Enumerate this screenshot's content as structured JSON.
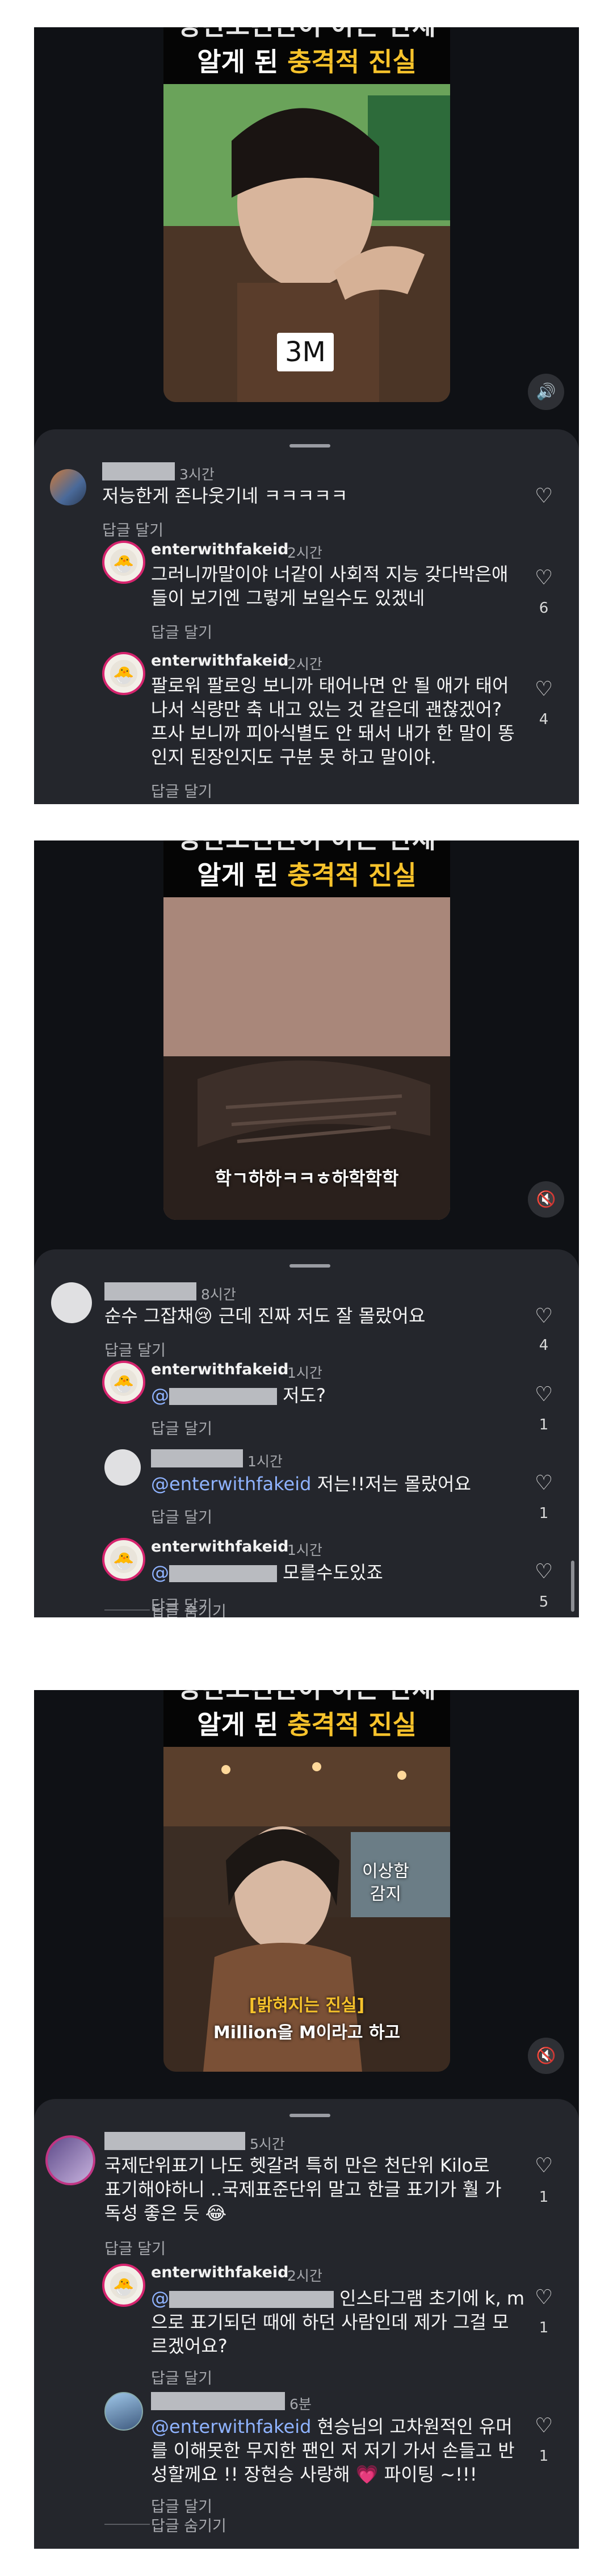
{
  "banner": {
    "line_top": "방탄소년단이 아는 단체",
    "main_prefix": "알게 된 ",
    "main_highlight": "충격적 진실"
  },
  "panel1": {
    "video_caption": "3M",
    "sound_icon": "sound-on",
    "comments": [
      {
        "time": "3시간",
        "text": "저능한게 존나웃기네 ㅋㅋㅋㅋㅋ",
        "reply": "답글 달기"
      },
      {
        "username": "enterwithfakeid",
        "time": "2시간",
        "text": "그러니까말이야 너같이 사회적 지능 갖다박은애\n들이 보기엔 그렇게 보일수도 있겠네",
        "reply": "답글 달기",
        "likes": "6"
      },
      {
        "username": "enterwithfakeid",
        "time": "2시간",
        "text": "팔로워 팔로잉 보니까 태어나면 안 될 애가 태어\n나서 식량만 축 내고 있는 것 같은데 괜찮겠어?\n프사 보니까 피아식별도 안 돼서 내가 한 말이 똥\n인지 된장인지도 구분 못 하고 말이야.",
        "reply": "답글 달기",
        "likes": "4"
      }
    ]
  },
  "panel2": {
    "video_caption": "학ㄱ하하ㅋㅋㅎ하학학학",
    "sound_icon": "sound-muted",
    "comments": [
      {
        "time": "8시간",
        "text": "순수 그잡채😢 근데 진짜 저도 잘  몰랐어요",
        "reply": "답글 달기",
        "likes": "4"
      },
      {
        "username": "enterwithfakeid",
        "time": "1시간",
        "mention": "@",
        "text": " 저도?",
        "reply": "답글 달기",
        "likes": "1"
      },
      {
        "time": "1시간",
        "mention": "@enterwithfakeid",
        "text": " 저는!!저는 몰랐어요",
        "reply": "답글 달기",
        "likes": "1"
      },
      {
        "username": "enterwithfakeid",
        "time": "1시간",
        "mention": "@",
        "text": " 모를수도있죠",
        "reply": "답글 달기",
        "likes": "5"
      }
    ],
    "hide_replies": "답글 숨기기"
  },
  "panel3": {
    "video_label": "이상함\n감지",
    "subtitle_yellow": "[밝혀지는 진실]",
    "subtitle_white": "Million을 M이라고 하고",
    "sound_icon": "sound-muted",
    "comments": [
      {
        "time": "5시간",
        "text": "국제단위표기  나도 헷갈려  특히 만은 천단위 Kilo로\n표기해야하니 ..국제표준단위 말고  한글 표기가 훨 가\n독성 좋은 듯 😂",
        "reply": "답글 달기",
        "likes": "1"
      },
      {
        "username": "enterwithfakeid",
        "time": "2시간",
        "mention": "@",
        "text": " 인스타그램 초기에 k, m\n으로 표기되던 때에 하던 사람인데 제가 그걸 모\n르겠어요?",
        "reply": "답글 달기",
        "likes": "1"
      },
      {
        "time": "6분",
        "mention": "@enterwithfakeid",
        "text": " 현승님의 고차원적인 유머\n를 이해못한 무지한 팬인 저 저기 가서 손들고 반\n성할께요 !! 장현승 사랑해 💗 파이팅 ~!!!",
        "reply": "답글 달기",
        "likes": "1"
      }
    ],
    "hide_replies": "답글 숨기기"
  }
}
